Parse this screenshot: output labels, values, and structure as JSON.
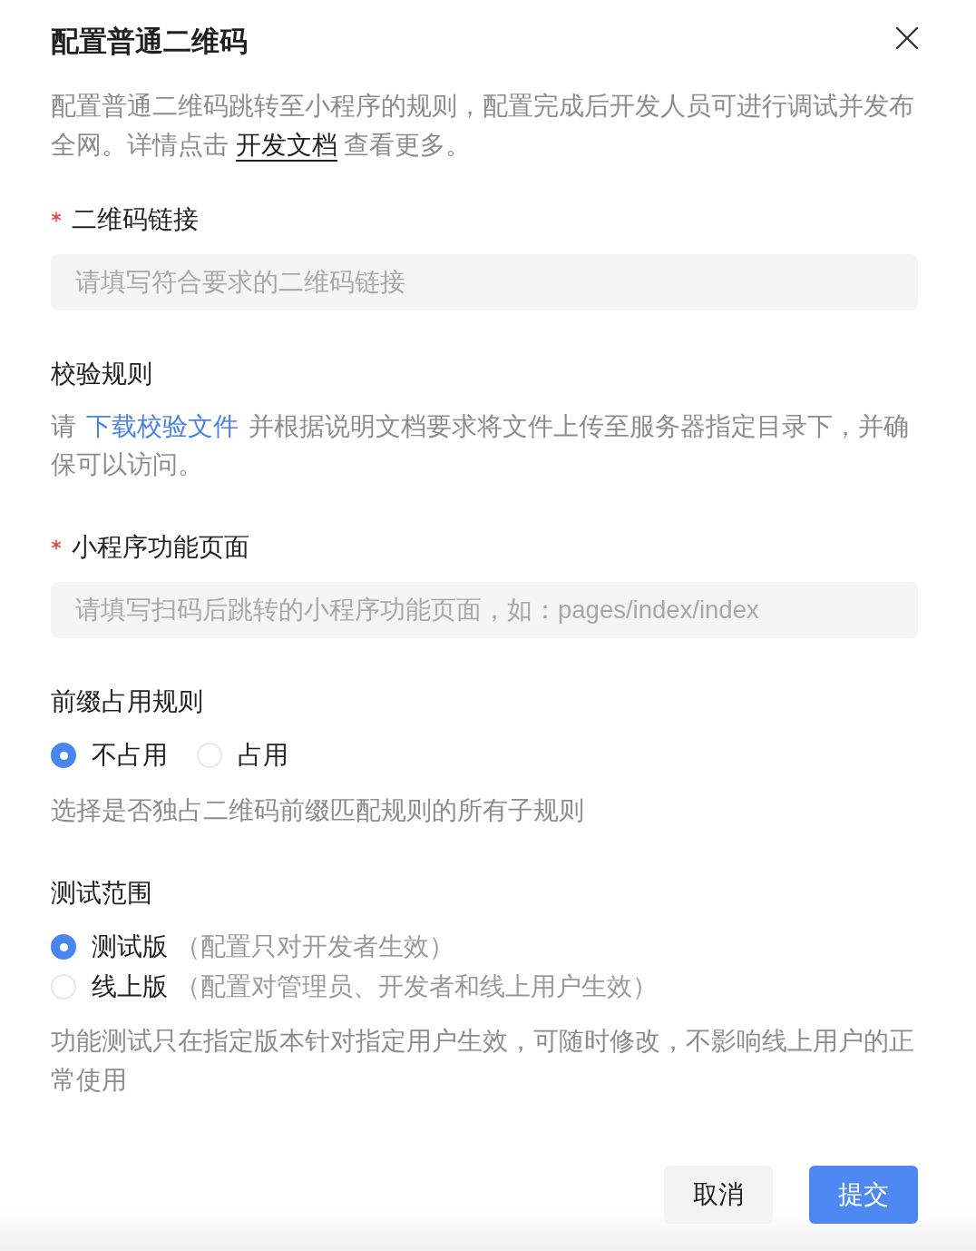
{
  "dialog": {
    "title": "配置普通二维码"
  },
  "description": {
    "before": "配置普通二维码跳转至小程序的规则，配置完成后开发人员可进行调试并发布全网。详情点击 ",
    "link": "开发文档",
    "after": " 查看更多。"
  },
  "fields": [
    {
      "kind": "input",
      "label": "二维码链接",
      "required": true,
      "placeholder": "请填写符合要求的二维码链接"
    },
    {
      "kind": "text",
      "label": "校验规则",
      "required": false,
      "text": {
        "before": "请",
        "link": "下载校验文件",
        "after": "并根据说明文档要求将文件上传至服务器指定目录下，并确保可以访问。"
      }
    },
    {
      "kind": "input",
      "label": "小程序功能页面",
      "required": true,
      "placeholder": "请填写扫码后跳转的小程序功能页面，如：pages/index/index"
    },
    {
      "kind": "radio_row",
      "label": "前缀占用规则",
      "required": false,
      "options": [
        {
          "label": "不占用",
          "selected": true
        },
        {
          "label": "占用",
          "selected": false
        }
      ],
      "help": "选择是否独占二维码前缀匹配规则的所有子规则"
    },
    {
      "kind": "radio_column",
      "label": "测试范围",
      "required": false,
      "options": [
        {
          "label": "测试版",
          "note": "（配置只对开发者生效）",
          "selected": true
        },
        {
          "label": "线上版",
          "note": "（配置对管理员、开发者和线上用户生效）",
          "selected": false
        }
      ],
      "help": "功能测试只在指定版本针对指定用户生效，可随时修改，不影响线上用户的正常使用"
    }
  ],
  "buttons": [
    {
      "label": "取消",
      "kind": "secondary"
    },
    {
      "label": "提交",
      "kind": "primary"
    }
  ]
}
